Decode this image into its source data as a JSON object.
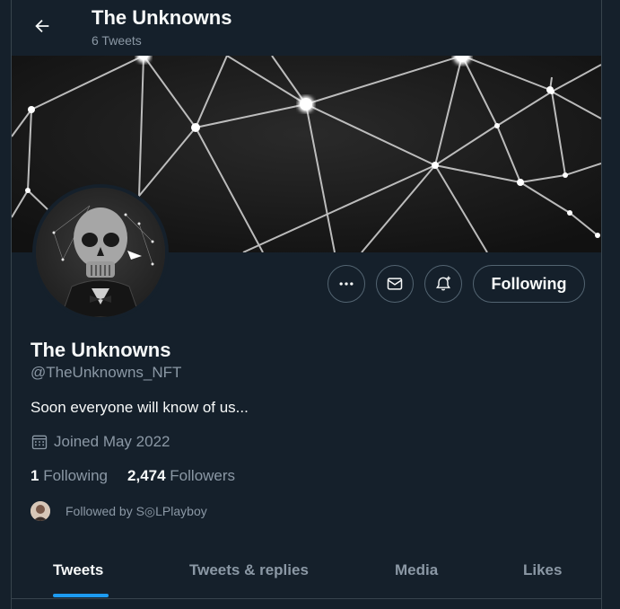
{
  "header": {
    "title": "The Unknowns",
    "tweet_count": "6 Tweets"
  },
  "profile": {
    "name": "The Unknowns",
    "handle": "@TheUnknowns_NFT",
    "bio": "Soon everyone will know of us...",
    "joined": "Joined May 2022",
    "following_count": "1",
    "following_label": "Following",
    "followers_count": "2,474",
    "followers_label": "Followers",
    "followed_by": "Followed by S◎LPlayboy"
  },
  "actions": {
    "following_label": "Following"
  },
  "tabs": [
    {
      "label": "Tweets",
      "active": true
    },
    {
      "label": "Tweets & replies",
      "active": false
    },
    {
      "label": "Media",
      "active": false
    },
    {
      "label": "Likes",
      "active": false
    }
  ],
  "colors": {
    "background": "#15202b",
    "accent": "#1d9bf0",
    "muted": "#8b98a5",
    "border": "#38444d"
  },
  "icons": [
    "back-arrow-icon",
    "more-icon",
    "mail-icon",
    "bell-plus-icon",
    "calendar-icon"
  ]
}
